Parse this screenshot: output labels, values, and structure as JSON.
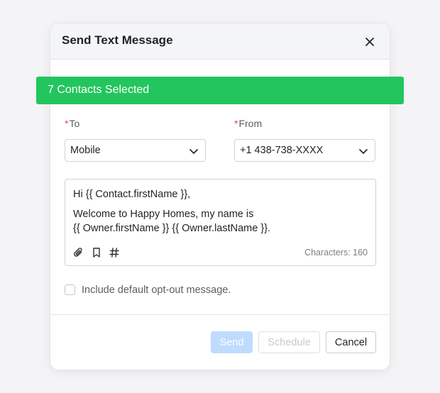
{
  "modal": {
    "title": "Send Text Message"
  },
  "banner": {
    "text": "7 Contacts Selected",
    "color": "#22c55e"
  },
  "to": {
    "required_mark": "*",
    "label": "To",
    "value": "Mobile"
  },
  "from": {
    "required_mark": "*",
    "label": "From",
    "value": "+1 438-738-XXXX"
  },
  "message": {
    "line1": "Hi {{ Contact.firstName }},",
    "line2": "Welcome to Happy Homes, my name is",
    "line3": "{{ Owner.firstName }} {{ Owner.lastName }}.",
    "char_count": "Characters: 160"
  },
  "toolbar_icons": [
    "paperclip-icon",
    "bookmark-icon",
    "hash-icon"
  ],
  "opt_out": {
    "label": "Include default opt-out message.",
    "checked": false
  },
  "buttons": {
    "send": "Send",
    "schedule": "Schedule",
    "cancel": "Cancel"
  }
}
